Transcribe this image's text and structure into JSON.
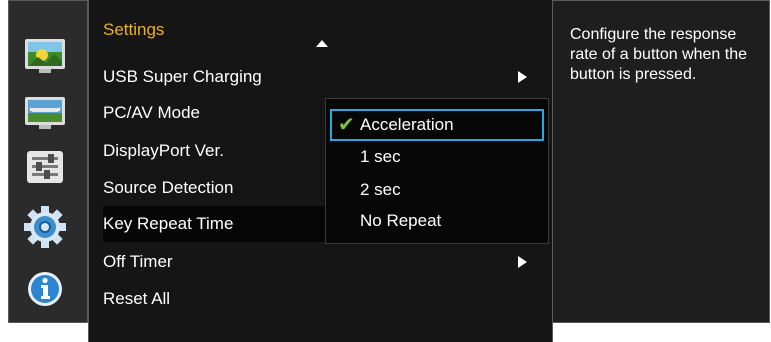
{
  "sidebar": {
    "icons": [
      {
        "name": "picture-icon"
      },
      {
        "name": "onscreen-display-icon"
      },
      {
        "name": "setup-icon"
      },
      {
        "name": "settings-gear-icon"
      },
      {
        "name": "information-icon"
      }
    ]
  },
  "menu": {
    "title": "Settings",
    "items": [
      {
        "label": "USB Super Charging",
        "has_submenu": true
      },
      {
        "label": "PC/AV Mode",
        "has_submenu": false
      },
      {
        "label": "DisplayPort Ver.",
        "has_submenu": false
      },
      {
        "label": "Source Detection",
        "has_submenu": false
      },
      {
        "label": "Key Repeat Time",
        "has_submenu": false,
        "selected": true
      },
      {
        "label": "Off Timer",
        "has_submenu": true
      },
      {
        "label": "Reset All",
        "has_submenu": false
      }
    ]
  },
  "popup": {
    "options": [
      {
        "label": "Acceleration",
        "checked": true
      },
      {
        "label": "1 sec",
        "checked": false
      },
      {
        "label": "2 sec",
        "checked": false
      },
      {
        "label": "No Repeat",
        "checked": false
      }
    ]
  },
  "help": {
    "text": "Configure the response rate of a button when the button is pressed."
  },
  "colors": {
    "title": "#e8b31c",
    "check": "#7dc241",
    "focus": "#2aa6e0"
  }
}
